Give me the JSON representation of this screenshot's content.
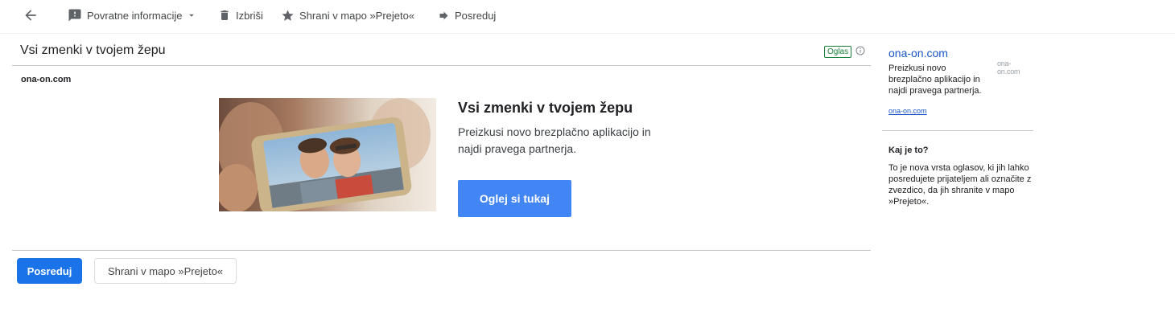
{
  "toolbar": {
    "feedback_label": "Povratne informacije",
    "delete_label": "Izbriši",
    "save_label": "Shrani v mapo »Prejeto«",
    "forward_label": "Posreduj"
  },
  "ad": {
    "subject": "Vsi zmenki v tvojem žepu",
    "badge": "Oglas",
    "sender": "ona-on.com",
    "headline": "Vsi zmenki v tvojem žepu",
    "description": "Preizkusi novo brezplačno aplikacijo in najdi pravega partnerja.",
    "cta_label": "Oglej si tukaj"
  },
  "actions": {
    "forward_label": "Posreduj",
    "save_label": "Shrani v mapo »Prejeto«"
  },
  "sidebar": {
    "domain": "ona-on.com",
    "logo_text": "ona-on.com",
    "description": "Preizkusi novo brezplačno aplikacijo in najdi pravega partnerja.",
    "link": "ona-on.com",
    "what_title": "Kaj je to?",
    "what_text": "To je nova vrsta oglasov, ki jih lahko posredujete prijateljem ali označite z zvezdico, da jih shranite v mapo »Prejeto«."
  },
  "colors": {
    "accent": "#1a73e8",
    "cta": "#4285f4",
    "badge": "#188038",
    "link": "#1a56c7"
  }
}
